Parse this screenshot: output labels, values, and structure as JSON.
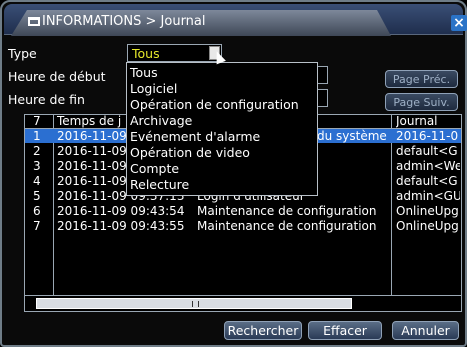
{
  "window": {
    "title": "INFORMATIONS > Journal",
    "close_icon": "close-icon",
    "title_icon": "folder-icon"
  },
  "filters": {
    "type_label": "Type",
    "type_value": "Tous",
    "start_label": "Heure de début",
    "end_label": "Heure de fin",
    "prev_page": "Page Préc.",
    "next_page": "Page Suiv."
  },
  "dropdown": {
    "options": [
      "Tous",
      "Logiciel",
      "Opération de configuration",
      "Archivage",
      "Evénement d'alarme",
      "Opération de video",
      "Compte",
      "Relecture"
    ]
  },
  "table": {
    "headers": {
      "index": "7",
      "time": "Temps de j",
      "journal": "Journal"
    },
    "rows": [
      {
        "index": "1",
        "time": "2016-11-09",
        "event": "du système",
        "journal": "2016-11-0"
      },
      {
        "index": "2",
        "time": "2016-11-09",
        "event": "",
        "journal": "default<G"
      },
      {
        "index": "3",
        "time": "2016-11-09",
        "event": "",
        "journal": "admin<We"
      },
      {
        "index": "4",
        "time": "2016-11-09",
        "event": "",
        "journal": "default<G"
      },
      {
        "index": "5",
        "time": "2016-11-09 09:37:13",
        "event": "Login d'utilisateur",
        "journal": "admin<GU"
      },
      {
        "index": "6",
        "time": "2016-11-09 09:43:54",
        "event": "Maintenance de configuration",
        "journal": "OnlineUpg"
      },
      {
        "index": "7",
        "time": "2016-11-09 09:43:55",
        "event": "Maintenance de configuration",
        "journal": "OnlineUpg"
      }
    ]
  },
  "actions": {
    "search": "Rechercher",
    "clear": "Effacer",
    "cancel": "Annuler"
  },
  "colors": {
    "selection": "#2b6fd1",
    "selected_value": "#e6e82b",
    "close_button": "#2a73c7"
  }
}
